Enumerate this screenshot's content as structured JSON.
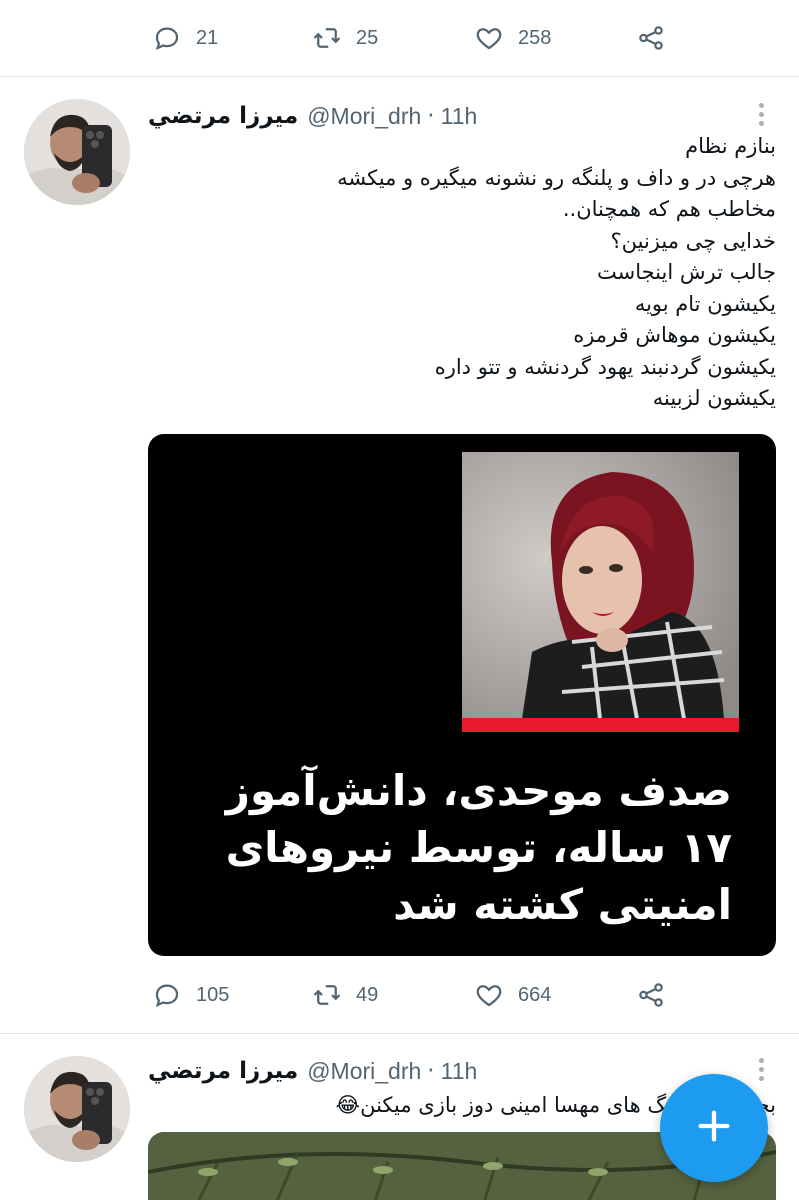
{
  "top_actions": {
    "reply": "21",
    "retweet": "25",
    "like": "258"
  },
  "tweet1": {
    "name": "میرزا مرتضي",
    "handle": "@Mori_drh",
    "time": "11h",
    "text": "بنازم نظام\nهرچی در و داف و پلنگه رو نشونه میگیره و میکشه\nمخاطب هم که همچنان..\nخدایی چی میزنین؟\nجالب ترش اینجاست\nیکیشون تام بویه\nیکیشون موهاش قرمزه\nیکیشون گردنبند یهود گردنشه و تتو داره\nیکیشون لزبینه",
    "caption": "صدف موحدی، دانش‌آموز ۱۷ ساله، توسط نیروهای امنیتی کشته شد",
    "actions": {
      "reply": "105",
      "retweet": "49",
      "like": "664"
    }
  },
  "tweet2": {
    "name": "میرزا مرتضي",
    "handle": "@Mori_drh",
    "time": "11h",
    "text": "بچه‌ها با هشتگ های مهسا امینی دوز بازی میکنن😂"
  },
  "colors": {
    "accent": "#1d9bf0",
    "muted": "#536471",
    "red_bar": "#e8192c"
  },
  "icons": [
    "reply-icon",
    "retweet-icon",
    "like-icon",
    "share-icon",
    "more-icon",
    "compose-plus-icon"
  ]
}
